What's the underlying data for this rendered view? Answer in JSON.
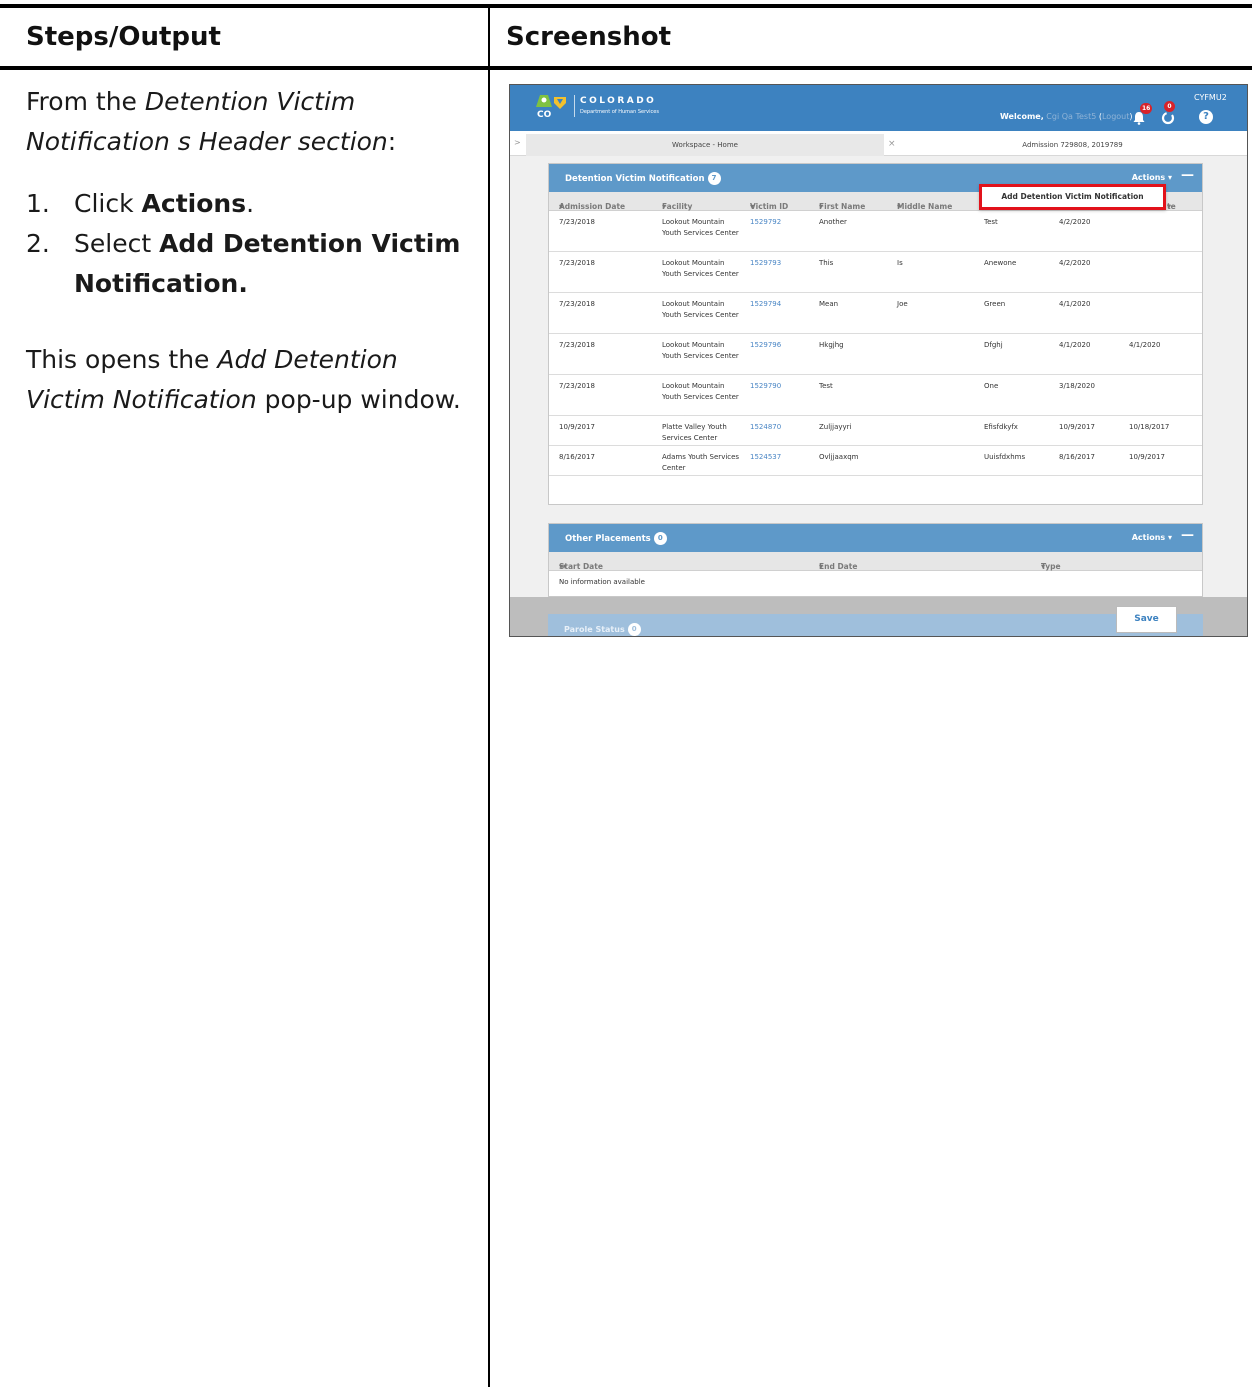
{
  "document": {
    "col_headers": {
      "left": "Steps/Output",
      "right": "Screenshot"
    },
    "intro": {
      "lead": "From the ",
      "italic": "Detention Victim Notification s Header section",
      "tail": ":"
    },
    "steps": [
      {
        "num": "1.",
        "pre": "Click ",
        "bold": "Actions",
        "post": "."
      },
      {
        "num": "2.",
        "pre": "Select ",
        "bold": "Add Detention Victim Notification.",
        "post": ""
      }
    ],
    "outro": {
      "lead": "This opens the ",
      "italic": "Add Detention Victim Notification",
      "tail": " pop-up window."
    }
  },
  "app": {
    "logo": {
      "badge": "CO",
      "line1": "COLORADO",
      "line2": "Department of Human Services"
    },
    "user_code": "CYFMU2",
    "welcome": {
      "prefix": "Welcome,",
      "name": "Cgi Qa Test5",
      "open": " (",
      "logout": "Logout",
      "close": ")"
    },
    "badges": {
      "notifications": "16",
      "alerts": "0"
    },
    "help": "?",
    "tabs": {
      "chevron": ">",
      "home": "Workspace - Home",
      "close": "×",
      "admission": "Admission 729808, 2019789"
    },
    "colors": {
      "header": "#3d82c0",
      "panel": "#5e99c9",
      "highlight": "#e2121b"
    }
  },
  "dvn_panel": {
    "title": "Detention Victim Notification",
    "count": "7",
    "actions": "Actions ▾",
    "minimize": "—",
    "columns": [
      "Admission Date",
      "Facility",
      "Victim ID",
      "First Name",
      "Middle Name",
      "L",
      "te"
    ],
    "rows": [
      {
        "admission": "7/23/2018",
        "facility": "Lookout Mountain Youth Services Center",
        "victim_id": "1529792",
        "first": "Another",
        "middle": "",
        "last": "Test",
        "date1": "4/2/2020",
        "date2": ""
      },
      {
        "admission": "7/23/2018",
        "facility": "Lookout Mountain Youth Services Center",
        "victim_id": "1529793",
        "first": "This",
        "middle": "Is",
        "last": "Anewone",
        "date1": "4/2/2020",
        "date2": ""
      },
      {
        "admission": "7/23/2018",
        "facility": "Lookout Mountain Youth Services Center",
        "victim_id": "1529794",
        "first": "Mean",
        "middle": "Joe",
        "last": "Green",
        "date1": "4/1/2020",
        "date2": ""
      },
      {
        "admission": "7/23/2018",
        "facility": "Lookout Mountain Youth Services Center",
        "victim_id": "1529796",
        "first": "Hkgjhg",
        "middle": "",
        "last": "Dfghj",
        "date1": "4/1/2020",
        "date2": "4/1/2020"
      },
      {
        "admission": "7/23/2018",
        "facility": "Lookout Mountain Youth Services Center",
        "victim_id": "1529790",
        "first": "Test",
        "middle": "",
        "last": "One",
        "date1": "3/18/2020",
        "date2": ""
      },
      {
        "admission": "10/9/2017",
        "facility": "Platte Valley Youth Services Center",
        "victim_id": "1524870",
        "first": "Zuljjayyri",
        "middle": "",
        "last": "Efisfdkyfx",
        "date1": "10/9/2017",
        "date2": "10/18/2017"
      },
      {
        "admission": "8/16/2017",
        "facility": "Adams Youth Services Center",
        "victim_id": "1524537",
        "first": "Ovljjaaxqm",
        "middle": "",
        "last": "Uuisfdxhms",
        "date1": "8/16/2017",
        "date2": "10/9/2017"
      }
    ],
    "dropdown_item": "Add Detention Victim Notification"
  },
  "placements_panel": {
    "title": "Other Placements",
    "count": "0",
    "actions": "Actions ▾",
    "minimize": "—",
    "columns": [
      "Start Date",
      "End Date",
      "Type"
    ],
    "empty_text": "No information available"
  },
  "parole_panel": {
    "title": "Parole Status",
    "count": "0"
  },
  "save_label": "Save"
}
